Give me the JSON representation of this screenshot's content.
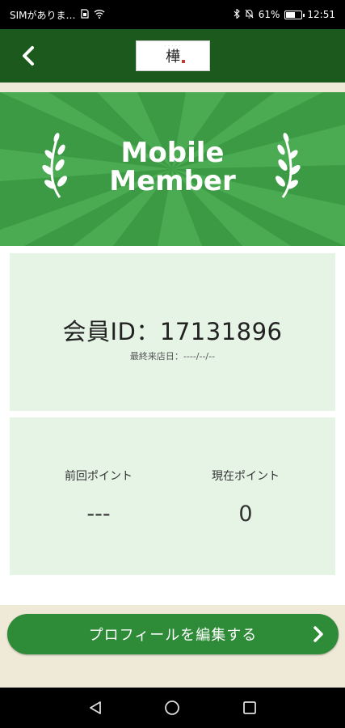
{
  "status_bar": {
    "carrier": "SIMがありま…",
    "battery_percent": "61%",
    "time": "12:51",
    "battery_level": 0.61
  },
  "header": {
    "back_icon": "chevron-left-icon",
    "logo_char": "樺"
  },
  "banner": {
    "title_line1": "Mobile",
    "title_line2": "Member",
    "colors": {
      "bg": "#3b9a43",
      "ray": "#4aab52"
    }
  },
  "member": {
    "id_label": "会員ID：",
    "id_value": "17131896",
    "last_visit": "最終来店日：----/--/--"
  },
  "points": {
    "previous_label": "前回ポイント",
    "previous_value": "---",
    "current_label": "現在ポイント",
    "current_value": "0"
  },
  "actions": {
    "edit_profile_label": "プロフィールを編集する"
  },
  "theme": {
    "header_green": "#1b5a1c",
    "button_green": "#2e8b37",
    "panel_bg": "#e6f4e6"
  }
}
